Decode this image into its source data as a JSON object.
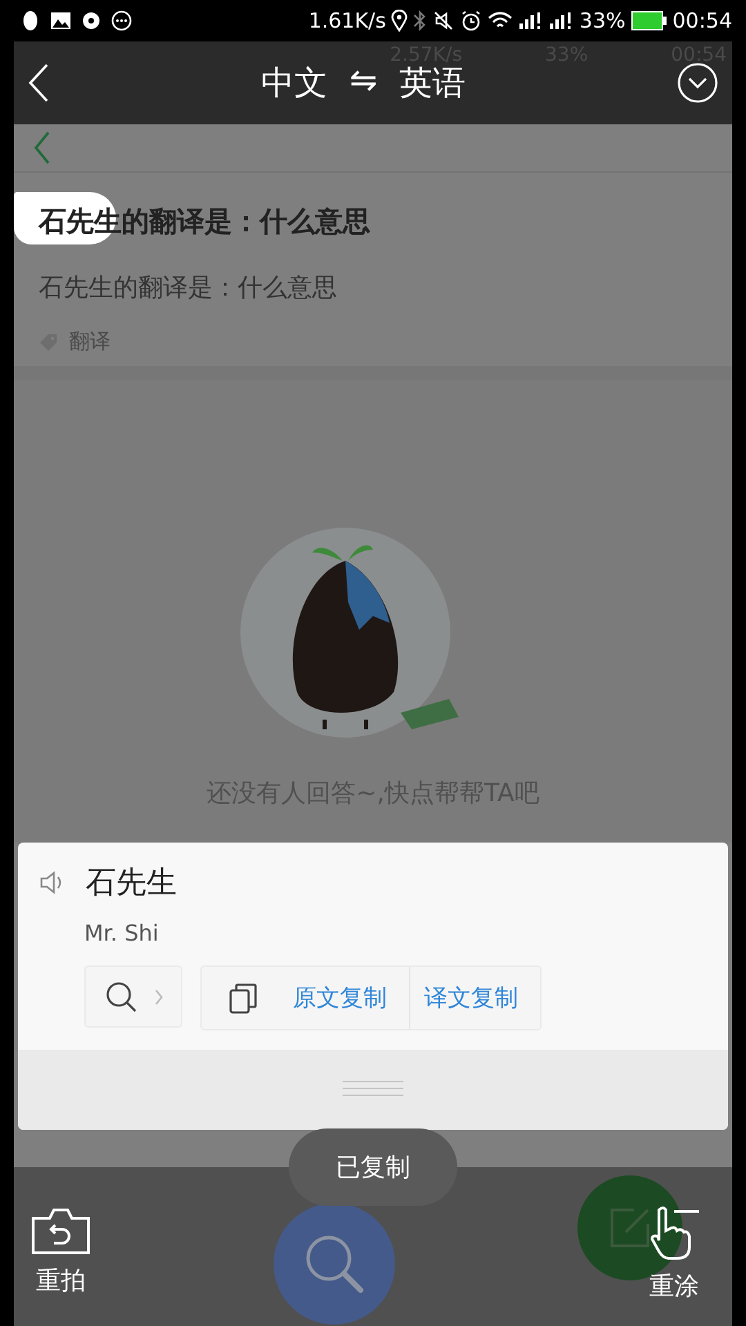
{
  "status_bar": {
    "speed": "1.61K/s",
    "battery": "33%",
    "time": "00:54"
  },
  "background_status_bar": {
    "speed": "2.57K/s",
    "battery": "33%",
    "time": "00:54"
  },
  "header": {
    "source_language": "中文",
    "swap_symbol": "⇋",
    "target_language": "英语"
  },
  "question": {
    "title_highlighted": "石先生",
    "title_rest": "的翻译是：什么意思",
    "body": "石先生的翻译是：什么意思",
    "tag": "翻译"
  },
  "empty_state": {
    "message": "还没有人回答~,快点帮帮TA吧"
  },
  "translation_card": {
    "source": "石先生",
    "translation": "Mr. Shi",
    "actions": [
      "原文复制",
      "译文复制"
    ]
  },
  "toast": "已复制",
  "bottom_bar": {
    "retake": "重拍",
    "repaint": "重涂"
  }
}
